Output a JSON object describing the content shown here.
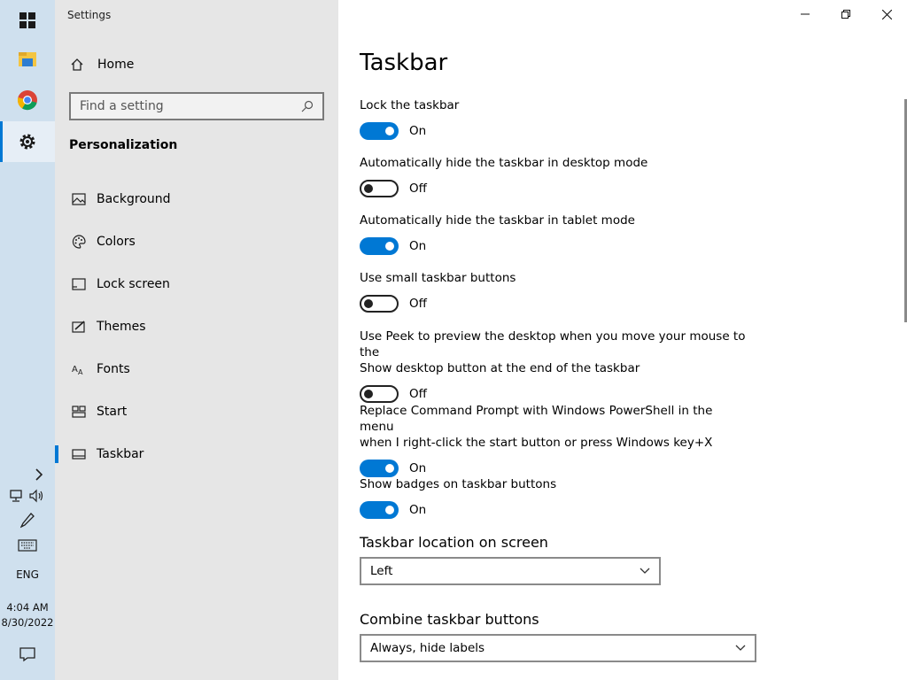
{
  "window": {
    "title": "Settings"
  },
  "taskbar": {
    "icons": [
      "windows-start-icon",
      "file-explorer-icon",
      "chrome-icon",
      "settings-gear-icon"
    ],
    "language": "ENG",
    "time": "4:04 AM",
    "date": "8/30/2022"
  },
  "nav": {
    "home_label": "Home",
    "search_placeholder": "Find a setting",
    "section_title": "Personalization",
    "items": [
      {
        "label": "Background",
        "icon": "picture-icon"
      },
      {
        "label": "Colors",
        "icon": "palette-icon"
      },
      {
        "label": "Lock screen",
        "icon": "lock-screen-icon"
      },
      {
        "label": "Themes",
        "icon": "themes-icon"
      },
      {
        "label": "Fonts",
        "icon": "fonts-icon"
      },
      {
        "label": "Start",
        "icon": "start-icon"
      },
      {
        "label": "Taskbar",
        "icon": "taskbar-icon",
        "selected": true
      }
    ]
  },
  "content": {
    "title": "Taskbar",
    "settings": [
      {
        "label": "Lock the taskbar",
        "state": "On"
      },
      {
        "label": "Automatically hide the taskbar in desktop mode",
        "state": "Off"
      },
      {
        "label": "Automatically hide the taskbar in tablet mode",
        "state": "On"
      },
      {
        "label": "Use small taskbar buttons",
        "state": "Off"
      },
      {
        "label_line1": "Use Peek to preview the desktop when you move your mouse to the",
        "label_line2": "Show desktop button at the end of the taskbar",
        "state": "Off"
      },
      {
        "label_line1": "Replace Command Prompt with Windows PowerShell in the menu",
        "label_line2": "when I right-click the start button or press Windows key+X",
        "state": "On"
      },
      {
        "label": "Show badges on taskbar buttons",
        "state": "On"
      }
    ],
    "location": {
      "label": "Taskbar location on screen",
      "value": "Left"
    },
    "combine": {
      "label": "Combine taskbar buttons",
      "value": "Always, hide labels"
    }
  },
  "colors": {
    "accent": "#0078d4",
    "nav_bg": "#e6e6e6",
    "taskbar_bg": "#cfe0ee"
  }
}
